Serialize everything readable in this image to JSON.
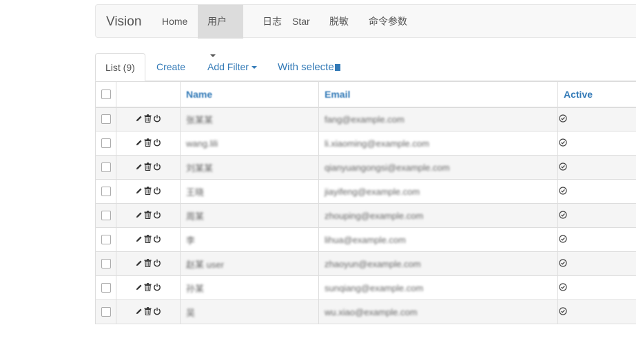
{
  "navbar": {
    "brand": "Vision",
    "items": [
      {
        "label": "Home"
      },
      {
        "label": "用户"
      },
      {
        "label": "日志"
      },
      {
        "label": "Star"
      },
      {
        "label": "脱敏"
      },
      {
        "label": "命令参数"
      }
    ]
  },
  "tabs": {
    "list": "List (9)",
    "create": "Create",
    "add_filter": "Add Filter",
    "with_selected": "With selecte"
  },
  "table": {
    "headers": {
      "name": "Name",
      "email": "Email",
      "active": "Active"
    },
    "rows": [
      {
        "name": "张某某",
        "email": "fang@example.com"
      },
      {
        "name": "wang.lili",
        "email": "li.xiaoming@example.com"
      },
      {
        "name": "刘某某",
        "email": "qianyuangongsi@example.com"
      },
      {
        "name": "王晓",
        "email": "jiayifeng@example.com"
      },
      {
        "name": "周某",
        "email": "zhouping@example.com"
      },
      {
        "name": "李",
        "email": "lihua@example.com"
      },
      {
        "name": "赵某 user",
        "email": "zhaoyun@example.com"
      },
      {
        "name": "孙某",
        "email": "sunqiang@example.com"
      },
      {
        "name": "吴",
        "email": "wu.xiao@example.com"
      }
    ]
  }
}
